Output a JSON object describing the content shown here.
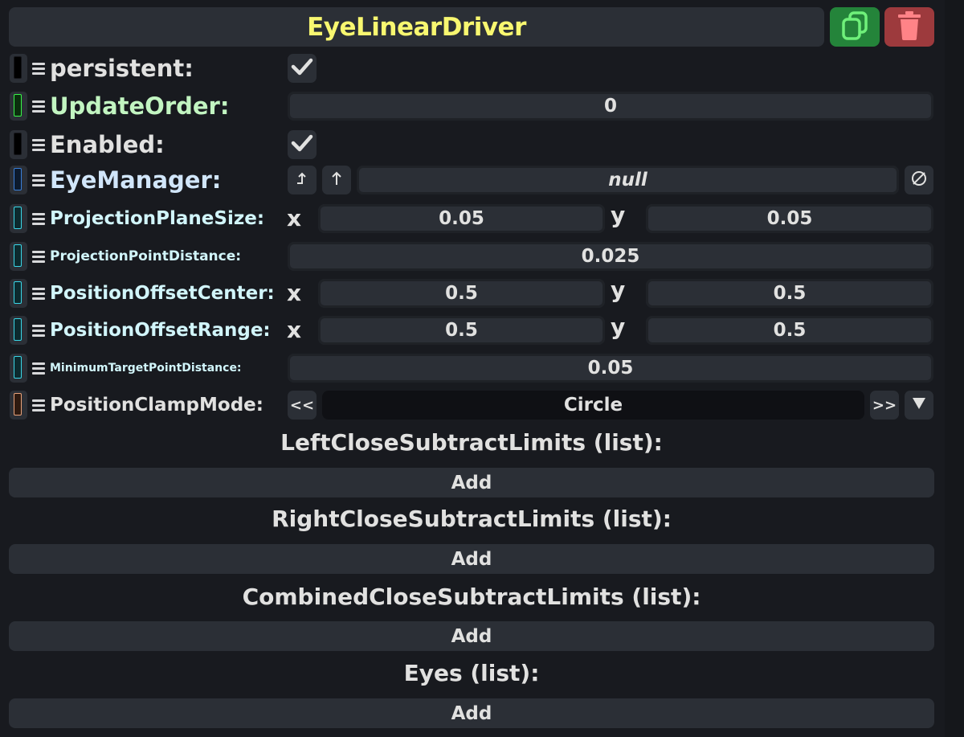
{
  "header": {
    "title": "EyeLinearDriver",
    "duplicate_icon": "duplicate-icon",
    "delete_icon": "trash-icon"
  },
  "fields": {
    "persistent": {
      "label": "persistent:",
      "checked": true
    },
    "update_order": {
      "label": "UpdateOrder:",
      "value": "0"
    },
    "enabled": {
      "label": "Enabled:",
      "checked": true
    },
    "eye_manager": {
      "label": "EyeManager:",
      "value": "null",
      "jump_icon": "jump-to-icon",
      "up_icon": "arrow-up-icon",
      "clear_icon": "null-icon"
    },
    "projection_plane_size": {
      "label": "ProjectionPlaneSize:",
      "x_label": "x",
      "x": "0.05",
      "y_label": "y",
      "y": "0.05"
    },
    "projection_point_distance": {
      "label": "ProjectionPointDistance:",
      "value": "0.025"
    },
    "position_offset_center": {
      "label": "PositionOffsetCenter:",
      "x_label": "x",
      "x": "0.5",
      "y_label": "y",
      "y": "0.5"
    },
    "position_offset_range": {
      "label": "PositionOffsetRange:",
      "x_label": "x",
      "x": "0.5",
      "y_label": "y",
      "y": "0.5"
    },
    "minimum_target_point_distance": {
      "label": "MinimumTargetPointDistance:",
      "value": "0.05"
    },
    "position_clamp_mode": {
      "label": "PositionClampMode:",
      "prev": "<<",
      "value": "Circle",
      "next": ">>",
      "dropdown_icon": "triangle-down-icon"
    }
  },
  "lists": [
    {
      "title": "LeftCloseSubtractLimits (list):",
      "add_label": "Add"
    },
    {
      "title": "RightCloseSubtractLimits (list):",
      "add_label": "Add"
    },
    {
      "title": "CombinedCloseSubtractLimits (list):",
      "add_label": "Add"
    },
    {
      "title": "Eyes (list):",
      "add_label": "Add"
    }
  ],
  "colors": {
    "background": "#181a1f",
    "panel": "#2b2f36",
    "title": "#f8f770",
    "duplicate": "#24843a",
    "delete": "#9d3a3d",
    "update_order_label": "#c2f5c1",
    "cyan_labels": "#d1f5fa"
  }
}
